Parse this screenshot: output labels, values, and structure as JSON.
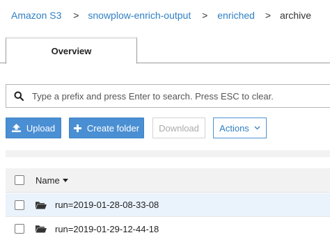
{
  "breadcrumb": {
    "items": [
      {
        "label": "Amazon S3"
      },
      {
        "label": "snowplow-enrich-output"
      },
      {
        "label": "enriched"
      },
      {
        "label": "archive"
      }
    ],
    "separator": ">"
  },
  "tabs": [
    {
      "label": "Overview",
      "active": true
    }
  ],
  "search": {
    "placeholder": "Type a prefix and press Enter to search. Press ESC to clear.",
    "value": "",
    "icon": "search-icon"
  },
  "toolbar": {
    "upload_label": "Upload",
    "create_folder_label": "Create folder",
    "download_label": "Download",
    "actions_label": "Actions"
  },
  "table": {
    "columns": [
      {
        "label": "Name",
        "sort": "descending"
      }
    ],
    "rows": [
      {
        "name": "run=2019-01-28-08-33-08",
        "type": "folder"
      },
      {
        "name": "run=2019-01-29-12-44-18",
        "type": "folder"
      }
    ]
  },
  "colors": {
    "link": "#2f7fc5",
    "primary_button": "#4a8fd3",
    "selected_row": "#eaf3fb",
    "header_bg": "#f2f2f2"
  }
}
